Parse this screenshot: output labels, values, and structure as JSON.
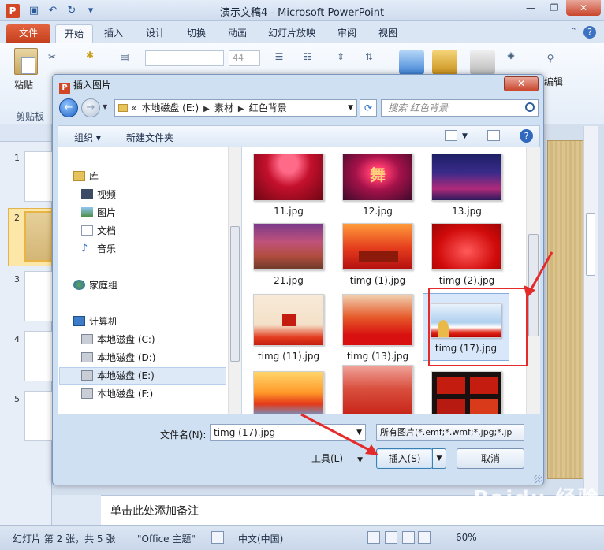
{
  "app": {
    "icon_letter": "P",
    "window_title": "演示文稿4 - Microsoft PowerPoint",
    "qat_icons": [
      "save-icon",
      "undo-icon",
      "redo-icon",
      "customize-icon"
    ]
  },
  "ribbon": {
    "tabs": [
      "文件",
      "开始",
      "插入",
      "设计",
      "切换",
      "动画",
      "幻灯片放映",
      "审阅",
      "视图"
    ],
    "active_tab": "开始",
    "paste_label": "粘贴",
    "clipboard_group": "剪贴板",
    "font_size_placeholder": "44",
    "edit_label": "编辑"
  },
  "slides": {
    "numbers": [
      "1",
      "2",
      "3",
      "4",
      "5"
    ],
    "selected": "2"
  },
  "notes_placeholder": "单击此处添加备注",
  "status": {
    "slide_info": "幻灯片 第 2 张，共 5 张",
    "theme": "\"Office 主题\"",
    "language": "中文(中国)",
    "zoom": "60%"
  },
  "dialog": {
    "title": "插入图片",
    "address": {
      "prefix": "«",
      "crumbs": [
        "本地磁盘 (E:)",
        "素材",
        "红色背景"
      ]
    },
    "search_placeholder": "搜索 红色背景",
    "toolbar": {
      "organize": "组织 ▾",
      "new_folder": "新建文件夹"
    },
    "nav": {
      "libraries": "库",
      "videos": "视频",
      "pictures": "图片",
      "documents": "文档",
      "music": "音乐",
      "homegroup": "家庭组",
      "computer": "计算机",
      "drive_c": "本地磁盘 (C:)",
      "drive_d": "本地磁盘 (D:)",
      "drive_e": "本地磁盘 (E:)",
      "drive_f": "本地磁盘 (F:)"
    },
    "files": [
      "11.jpg",
      "12.jpg",
      "13.jpg",
      "21.jpg",
      "timg (1).jpg",
      "timg (2).jpg",
      "timg (11).jpg",
      "timg (13).jpg",
      "timg (17).jpg",
      "",
      "",
      ""
    ],
    "selected_file": "timg (17).jpg",
    "filename_label": "文件名(N):",
    "filename_value": "timg (17).jpg",
    "filter": "所有图片(*.emf;*.wmf;*.jpg;*.jp",
    "tools": "工具(L)",
    "insert": "插入(S)",
    "cancel": "取消"
  },
  "watermark": "Baidu 经验",
  "colors": {
    "annotation_red": "#e32b2b",
    "ribbon_file_tab": "#d24726",
    "selection_blue": "#d8e7fa"
  }
}
